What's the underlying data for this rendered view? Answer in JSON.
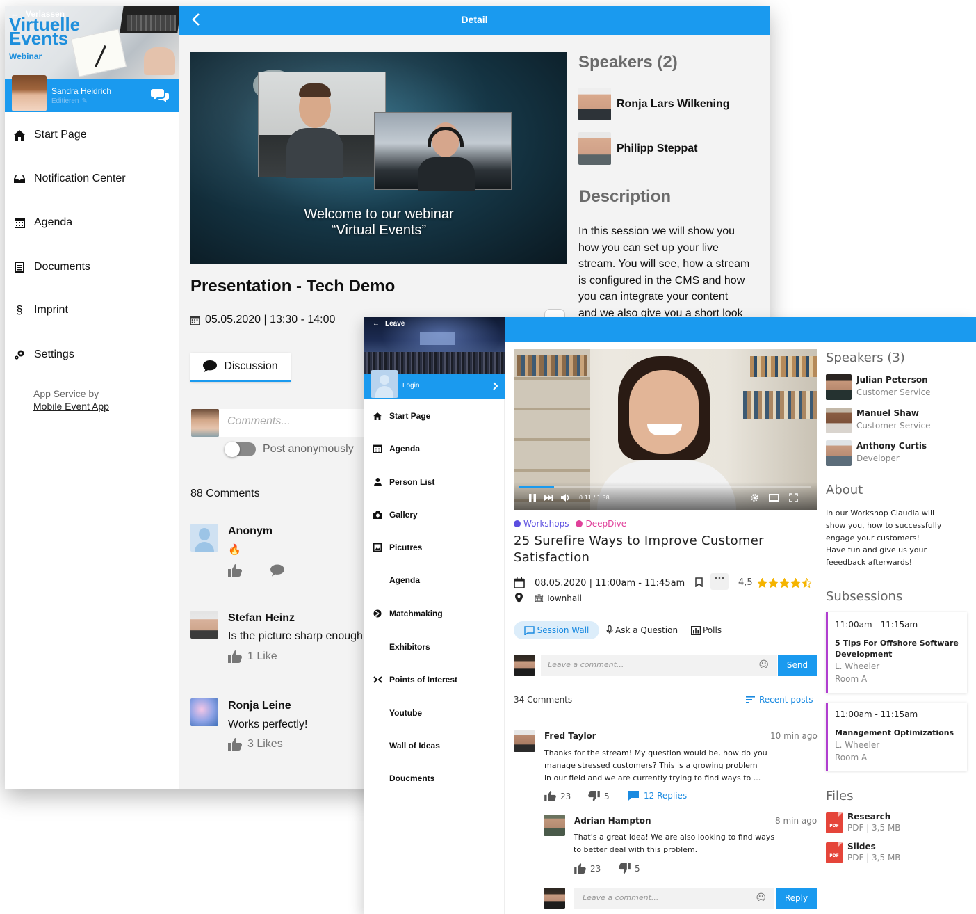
{
  "back": {
    "brand": {
      "leave": "Verlassen",
      "title1": "Virtuelle",
      "title2": "Events",
      "subtitle": "Webinar"
    },
    "user": {
      "name": "Sandra Heidrich",
      "edit": "Editieren"
    },
    "nav": [
      {
        "label": "Start Page",
        "icon": "home-icon"
      },
      {
        "label": "Notification Center",
        "icon": "inbox-icon"
      },
      {
        "label": "Agenda",
        "icon": "calendar-icon"
      },
      {
        "label": "Documents",
        "icon": "document-icon"
      },
      {
        "label": "Imprint",
        "icon": "paragraph-icon"
      },
      {
        "label": "Settings",
        "icon": "settings-icon"
      }
    ],
    "service": {
      "line1": "App Service by",
      "line2": "Mobile Event App"
    },
    "header": {
      "title": "Detail"
    },
    "video": {
      "caption1": "Welcome to our webinar",
      "caption2": "“Virtual Events”"
    },
    "session": {
      "title": "Presentation - Tech Demo",
      "date": "05.05.2020 | 13:30 - 14:00"
    },
    "discussion_tab": "Discussion",
    "comment_placeholder": "Comments...",
    "anon_label": "Post anonymously",
    "comment_count": "88 Comments",
    "comments": [
      {
        "name": "Anonym",
        "text": "🔥",
        "likes": ""
      },
      {
        "name": "Stefan Heinz",
        "text": "Is the picture sharp enough",
        "likes": "1 Like"
      },
      {
        "name": "Ronja Leine",
        "text": "Works perfectly!",
        "likes": "3 Likes"
      }
    ],
    "speakers_heading": "Speakers (2)",
    "speakers": [
      "Ronja Lars Wilkening",
      "Philipp Steppat"
    ],
    "description_heading": "Description",
    "description_lines": [
      "In this session we will show you",
      "how you can set up your live",
      "stream. You will see, how a stream",
      "is configured in the CMS and how",
      "you can integrate your content",
      "and we also give you a short look"
    ]
  },
  "front": {
    "leave": "Leave",
    "login": "Login",
    "nav": [
      {
        "label": "Start Page",
        "icon": "home-icon"
      },
      {
        "label": "Agenda",
        "icon": "calendar-icon"
      },
      {
        "label": "Person List",
        "icon": "person-icon"
      },
      {
        "label": "Gallery",
        "icon": "camera-icon"
      },
      {
        "label": "Picutres",
        "icon": "image-icon"
      },
      {
        "label": "Agenda",
        "icon": ""
      },
      {
        "label": "Matchmaking",
        "icon": "globe-icon"
      },
      {
        "label": "Exhibitors",
        "icon": ""
      },
      {
        "label": "Points of Interest",
        "icon": "collapse-icon"
      },
      {
        "label": "Youtube",
        "icon": ""
      },
      {
        "label": "Wall of Ideas",
        "icon": ""
      },
      {
        "label": "Doucments",
        "icon": ""
      }
    ],
    "video": {
      "time": "0:11 / 1:38",
      "progress": 0.12
    },
    "tags": [
      {
        "label": "Workshops",
        "color": "#5b4ee0"
      },
      {
        "label": "DeepDive",
        "color": "#e0409a"
      }
    ],
    "session": {
      "title_line1": "25 Surefire Ways to Improve Customer",
      "title_line2": "Satisfaction",
      "date": "08.05.2020 | 11:00am - 11:45am",
      "rating": "4,5",
      "rating_value": 4.5,
      "location": "Townhall"
    },
    "tabs": {
      "wall": "Session Wall",
      "ask": "Ask a Question",
      "polls": "Polls"
    },
    "comment_placeholder": "Leave a comment...",
    "send": "Send",
    "comment_count": "34 Comments",
    "sort": "Recent posts",
    "comment": {
      "name": "Fred Taylor",
      "time": "10 min ago",
      "lines": [
        "Thanks for the stream! My question would be, how do you",
        "manage stressed customers? This is a growing problem",
        "in our field and we are currently trying to find ways to ..."
      ],
      "up": "23",
      "down": "5",
      "replies": "12 Replies"
    },
    "reply": {
      "name": "Adrian Hampton",
      "time": "8 min ago",
      "lines": [
        "That's a great idea! We are also looking to find ways",
        "to better deal with this problem."
      ],
      "up": "23",
      "down": "5"
    },
    "reply_placeholder": "Leave a comment...",
    "reply_button": "Reply",
    "speakers_heading": "Speakers (3)",
    "speakers": [
      {
        "name": "Julian Peterson",
        "role": "Customer Service"
      },
      {
        "name": "Manuel Shaw",
        "role": "Customer Service"
      },
      {
        "name": "Anthony Curtis",
        "role": "Developer"
      }
    ],
    "about_heading": "About",
    "about_lines": [
      "In our Workshop Claudia will",
      "show you, how to successfully",
      "engage your customers!",
      "Have fun and give us your",
      "feeedback afterwards!"
    ],
    "subsessions_heading": "Subsessions",
    "subsessions": [
      {
        "time": "11:00am - 11:15am",
        "title1": "5 Tips For Offshore Software",
        "title2": "Development",
        "speaker": "L. Wheeler",
        "room": "Room A"
      },
      {
        "time": "11:00am - 11:15am",
        "title1": "Management Optimizations",
        "title2": "",
        "speaker": "L. Wheeler",
        "room": "Room A"
      }
    ],
    "files_heading": "Files",
    "files": [
      {
        "name": "Research",
        "meta": "PDF | 3,5 MB",
        "badge": "PDF"
      },
      {
        "name": "Slides",
        "meta": "PDF | 3,5 MB",
        "badge": "PDF"
      }
    ]
  }
}
